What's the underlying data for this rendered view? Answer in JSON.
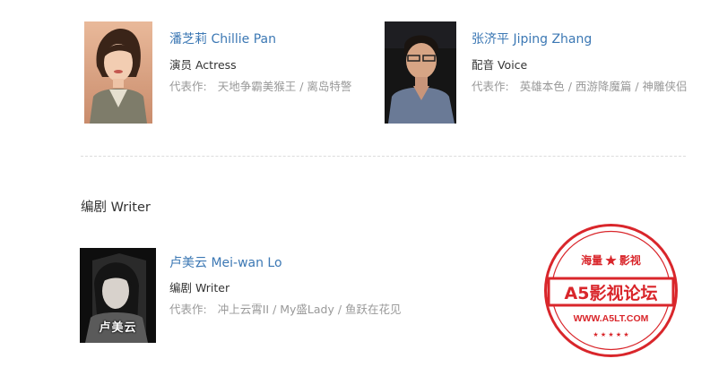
{
  "cast": [
    {
      "name": "潘芝莉 Chillie Pan",
      "role": "演员 Actress",
      "works_label": "代表作:",
      "works": "天地争霸美猴王 / 离岛特警"
    },
    {
      "name": "张济平 Jiping Zhang",
      "role": "配音 Voice",
      "works_label": "代表作:",
      "works": "英雄本色 / 西游降魔篇 / 神雕侠侣"
    }
  ],
  "writer_section": {
    "title": "编剧 Writer",
    "person": {
      "name": "卢美云 Mei-wan Lo",
      "role": "编剧 Writer",
      "works_label": "代表作:",
      "works": "冲上云霄II / My盛Lady / 鱼跃在花见",
      "photo_caption": "卢美云"
    }
  },
  "watermark": {
    "top_text": "海量 ★ 影视",
    "main_text": "A5影视论坛",
    "url": "WWW.A5LT.COM",
    "color": "#d9262b"
  },
  "colors": {
    "link": "#3c78b4",
    "muted": "#999999",
    "text": "#333333"
  }
}
